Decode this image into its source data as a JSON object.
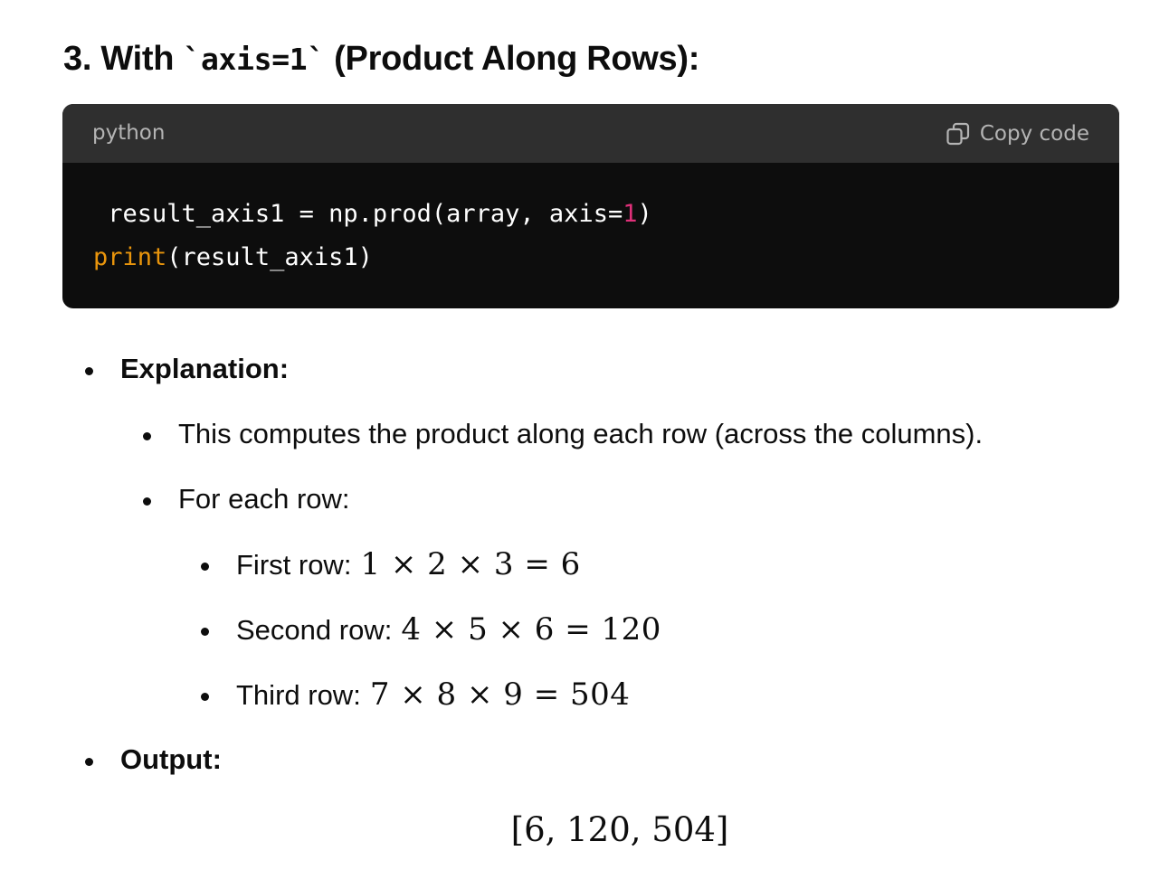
{
  "heading": {
    "prefix": "3. With ",
    "code": "`axis=1`",
    "suffix": " (Product Along Rows):"
  },
  "code_block": {
    "language": "python",
    "copy_label": "Copy code",
    "line1": {
      "a": "result_axis1 = np.prod(array, axis=",
      "num": "1",
      "b": ")"
    },
    "line2": {
      "builtin": "print",
      "rest": "(result_axis1)"
    }
  },
  "explanation": {
    "label": "Explanation:",
    "items": [
      "This computes the product along each row (across the columns).",
      "For each row:"
    ],
    "rows": [
      {
        "label": "First row:",
        "math": "1 × 2 × 3 = 6"
      },
      {
        "label": "Second row:",
        "math": "4 × 5 × 6 = 120"
      },
      {
        "label": "Third row:",
        "math": "7 × 8 × 9 = 504"
      }
    ]
  },
  "output": {
    "label": "Output:",
    "math": "[6, 120, 504]"
  }
}
